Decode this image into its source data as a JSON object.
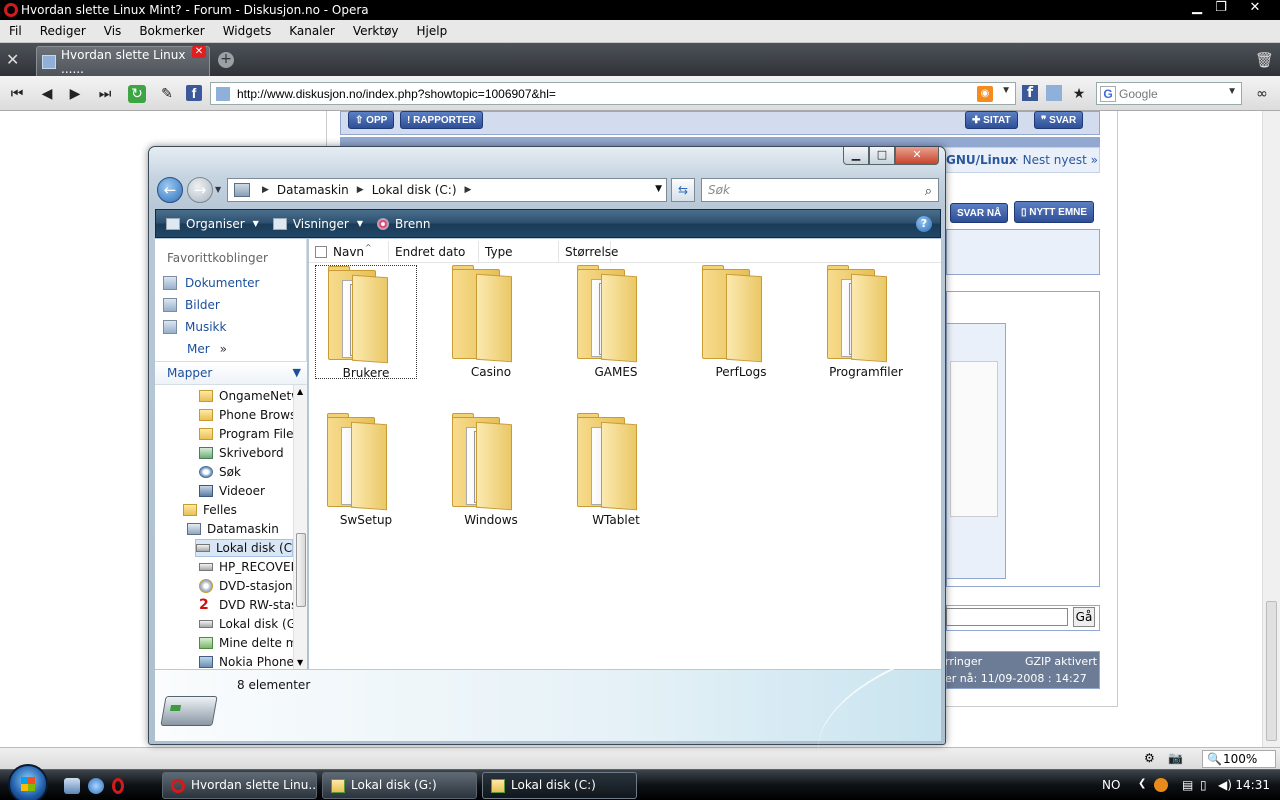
{
  "opera": {
    "title": "Hvordan slette Linux Mint? - Forum - Diskusjon.no - Opera",
    "menu": [
      "Fil",
      "Rediger",
      "Vis",
      "Bokmerker",
      "Widgets",
      "Kanaler",
      "Verktøy",
      "Hjelp"
    ],
    "tab_title": "Hvordan slette Linux ......",
    "address": "http://www.diskusjon.no/index.php?showtopic=1006907&hl=",
    "search_placeholder": "Google",
    "zoom": "100%"
  },
  "page": {
    "btn_opp": "OPP",
    "btn_rapporter": "RAPPORTER",
    "btn_sitat": "SITAT",
    "btn_svar": "SVAR",
    "nav_link": "GNU/Linux",
    "nest_nyest": "· Nest nyest »",
    "btn_svar_na": "SVAR NÅ",
    "btn_nytt_emne": "NYTT EMNE",
    "go_button": "Gå",
    "footer_1": "rringer",
    "footer_gzip": "GZIP aktivert",
    "footer_time": "er nå: 11/09-2008 : 14:27"
  },
  "explorer": {
    "breadcrumb": [
      "Datamaskin",
      "Lokal disk (C:)"
    ],
    "search_placeholder": "Søk",
    "commands": [
      {
        "label": "Organiser",
        "icon": "organize-icon"
      },
      {
        "label": "Visninger",
        "icon": "views-icon"
      },
      {
        "label": "Brenn",
        "icon": "burn-icon"
      }
    ],
    "favorites_title": "Favorittkoblinger",
    "favorites": [
      "Dokumenter",
      "Bilder",
      "Musikk"
    ],
    "more": "Mer",
    "folders_title": "Mapper",
    "tree": [
      {
        "label": "OngameNetw",
        "icon": "folder"
      },
      {
        "label": "Phone Browse",
        "icon": "folder"
      },
      {
        "label": "Program Files",
        "icon": "folder"
      },
      {
        "label": "Skrivebord",
        "icon": "green"
      },
      {
        "label": "Søk",
        "icon": "search"
      },
      {
        "label": "Videoer",
        "icon": "video"
      },
      {
        "label": "Felles",
        "icon": "folder"
      },
      {
        "label": "Datamaskin",
        "icon": "pc"
      },
      {
        "label": "Lokal disk (C:",
        "icon": "drive"
      },
      {
        "label": "HP_RECOVER",
        "icon": "drive"
      },
      {
        "label": "DVD-stasjon (",
        "icon": "dvd"
      },
      {
        "label": "DVD RW-stasj",
        "icon": "red"
      },
      {
        "label": "Lokal disk (G:",
        "icon": "drive"
      },
      {
        "label": "Mine delte m",
        "icon": "share"
      },
      {
        "label": "Nokia Phone",
        "icon": "phone"
      }
    ],
    "columns": [
      "Navn",
      "Endret dato",
      "Type",
      "Størrelse"
    ],
    "folders": [
      "Brukere",
      "Casino",
      "GAMES",
      "PerfLogs",
      "Programfiler",
      "SwSetup",
      "Windows",
      "WTablet"
    ],
    "item_count": "8 elementer"
  },
  "taskbar": {
    "buttons": [
      "Hvordan slette Linu...",
      "Lokal disk (G:)",
      "Lokal disk (C:)"
    ],
    "lang": "NO",
    "clock": "14:31"
  }
}
